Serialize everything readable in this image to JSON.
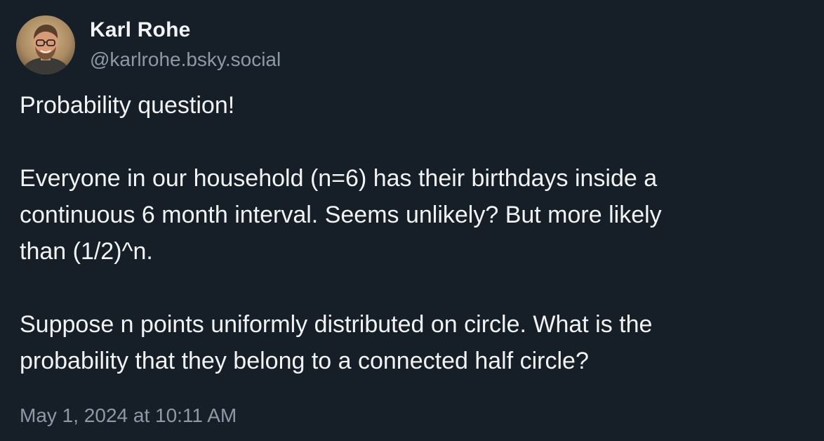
{
  "author": {
    "name": "Karl Rohe",
    "handle": "@karlrohe.bsky.social",
    "avatar_icon": "profile-photo"
  },
  "post": {
    "lines": {
      "p1": [
        "Probability question!"
      ],
      "p2": [
        "Everyone in our household (n=6) has their birthdays inside a",
        "continuous 6 month interval. Seems unlikely? But more likely",
        "than (1/2)^n."
      ],
      "p3": [
        "Suppose n points uniformly distributed on circle. What is the",
        "probability that they belong to a connected half circle?"
      ]
    },
    "timestamp": "May 1, 2024 at 10:11 AM"
  },
  "colors": {
    "background": "#161e27",
    "text_primary": "#f1f3f5",
    "text_secondary": "#8d99a6"
  }
}
